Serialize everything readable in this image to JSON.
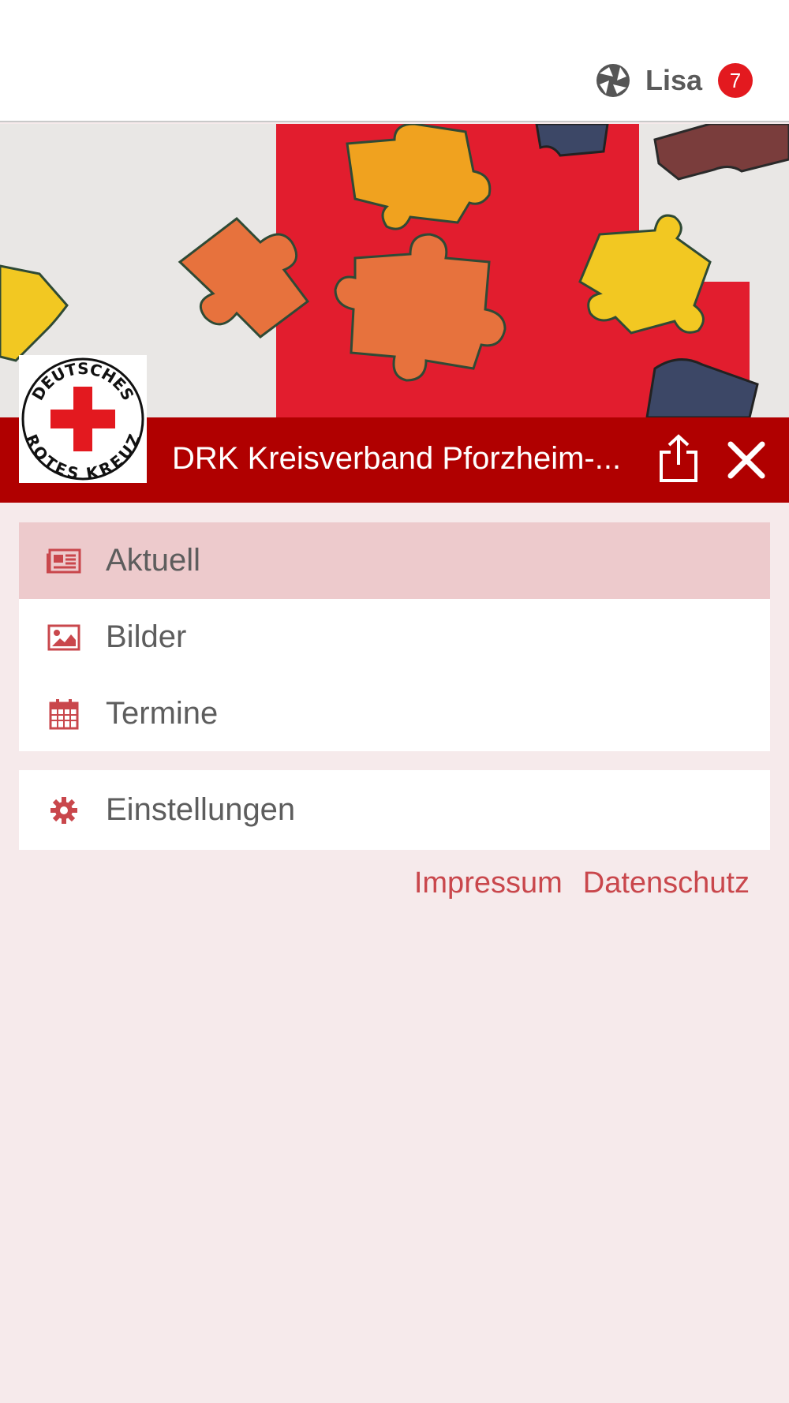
{
  "user": {
    "name": "Lisa",
    "notification_count": "7",
    "icon": "network-icon"
  },
  "header": {
    "title": "DRK Kreisverband Pforzheim-...",
    "share_icon": "share-icon",
    "close_icon": "close-icon"
  },
  "logo": {
    "text_top": "DEUTSCHES",
    "text_bottom": "ROTES KREUZ"
  },
  "menu": {
    "items": [
      {
        "label": "Aktuell",
        "icon": "newspaper-icon",
        "active": true
      },
      {
        "label": "Bilder",
        "icon": "image-icon",
        "active": false
      },
      {
        "label": "Termine",
        "icon": "calendar-icon",
        "active": false
      }
    ],
    "settings": {
      "label": "Einstellungen",
      "icon": "gear-icon"
    }
  },
  "footer": {
    "impressum": "Impressum",
    "datenschutz": "Datenschutz"
  },
  "colors": {
    "accent": "#b00000",
    "active_bg": "#edcacc",
    "page_bg": "#f6eaeb",
    "icon": "#c9474c",
    "badge": "#e3191f"
  }
}
